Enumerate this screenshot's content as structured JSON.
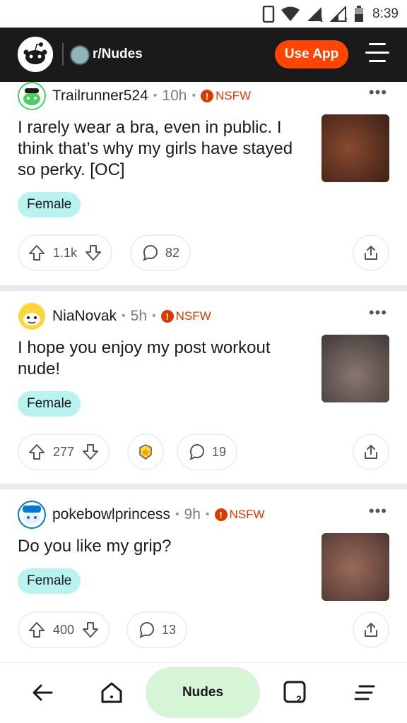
{
  "status_bar": {
    "time": "8:39"
  },
  "header": {
    "subreddit": "r/Nudes",
    "use_app_label": "Use App"
  },
  "posts": [
    {
      "author": "Trailrunner524",
      "age": "10h",
      "nsfw_label": "NSFW",
      "title": "I rarely wear a bra, even in public. I think that’s why my girls have stayed so perky. [OC]",
      "flair": "Female",
      "votes": "1.1k",
      "comments": "82"
    },
    {
      "author": "NiaNovak",
      "age": "5h",
      "nsfw_label": "NSFW",
      "title": "I hope you enjoy my post workout nude!",
      "flair": "Female",
      "votes": "277",
      "comments": "19"
    },
    {
      "author": "pokebowlprincess",
      "age": "9h",
      "nsfw_label": "NSFW",
      "title": "Do you like my grip?",
      "flair": "Female",
      "votes": "400",
      "comments": "13"
    }
  ],
  "bottom_nav": {
    "community_label": "Nudes",
    "tabs_count": "2"
  },
  "colors": {
    "accent": "#ff4500",
    "nsfw": "#d93a00",
    "flair_bg": "#b9f3ef",
    "nav_pill_bg": "#d6f5d6",
    "header_bg": "#1a1a1b"
  }
}
